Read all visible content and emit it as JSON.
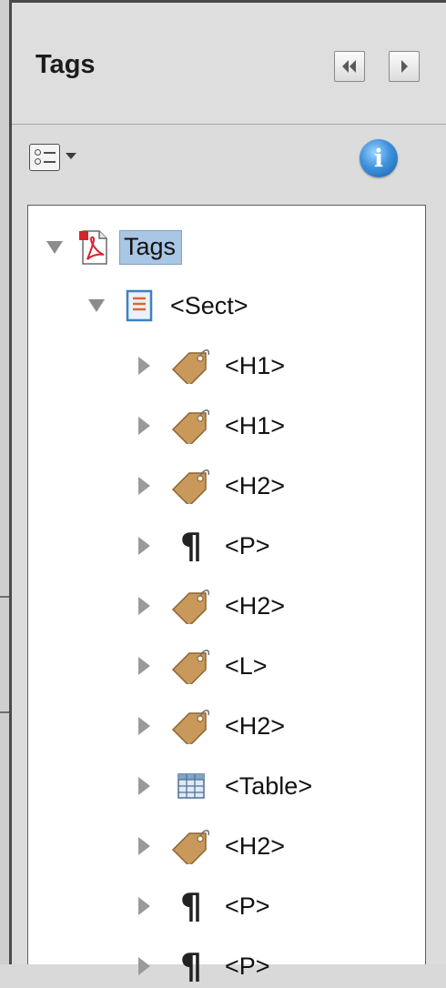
{
  "panel": {
    "title": "Tags",
    "collapse_button_glyph": "◀◀",
    "expand_button_glyph": "▶"
  },
  "toolbar": {
    "options_icon": "options-menu-icon",
    "info_icon": "info-icon",
    "info_glyph": "i"
  },
  "tree": {
    "root": {
      "label": "Tags",
      "icon": "pdf-document-icon",
      "expanded": true,
      "selected": true
    },
    "sect": {
      "label": "<Sect>",
      "icon": "section-icon",
      "expanded": true
    },
    "items": [
      {
        "label": "<H1>",
        "icon": "tag-icon"
      },
      {
        "label": "<H1>",
        "icon": "tag-icon"
      },
      {
        "label": "<H2>",
        "icon": "tag-icon"
      },
      {
        "label": "<P>",
        "icon": "paragraph-icon",
        "glyph": "¶"
      },
      {
        "label": "<H2>",
        "icon": "tag-icon"
      },
      {
        "label": "<L>",
        "icon": "tag-icon"
      },
      {
        "label": "<H2>",
        "icon": "tag-icon"
      },
      {
        "label": "<Table>",
        "icon": "table-icon"
      },
      {
        "label": "<H2>",
        "icon": "tag-icon"
      },
      {
        "label": "<P>",
        "icon": "paragraph-icon",
        "glyph": "¶"
      },
      {
        "label": "<P>",
        "icon": "paragraph-icon",
        "glyph": "¶"
      }
    ]
  },
  "colors": {
    "selection": "#a9c6e4",
    "tag": "#c49a5a",
    "pdf_red": "#d8232a",
    "info_blue": "#3f92dd"
  }
}
